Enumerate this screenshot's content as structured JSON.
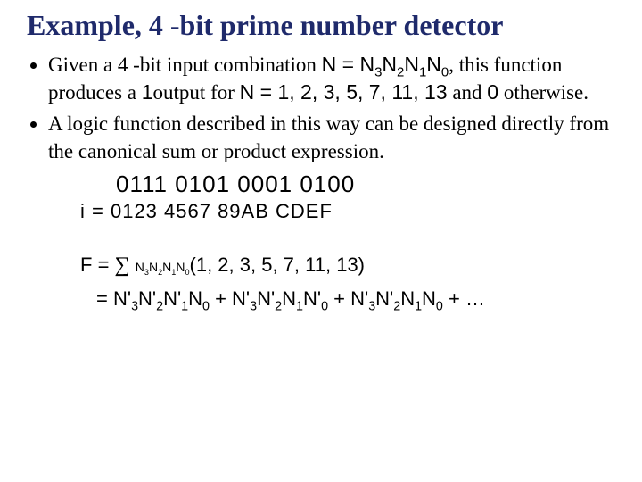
{
  "title": "Example, 4 -bit prime number detector",
  "bullet1_pre": "Given a 4 -bit input combination ",
  "bullet1_N": "N = N",
  "bullet1_s3": "3",
  "bullet1_N2": "N",
  "bullet1_s2": "2",
  "bullet1_N1": "N",
  "bullet1_s1": "1",
  "bullet1_N0": "N",
  "bullet1_s0": "0",
  "bullet1_mid": ", this function produces a ",
  "bullet1_one": "1",
  "bullet1_outfor": "output for ",
  "bullet1_Neq": "N = 1, 2, 3, 5, 7, 11, 13",
  "bullet1_and": " and ",
  "bullet1_zero": "0",
  "bullet1_oth": " otherwise.",
  "bullet2": "A logic function described in this way can be designed directly from the canonical sum or product expression.",
  "binrow": "0111 0101 0001 0100",
  "idx_i": "i = ",
  "idx_vals": "0123 4567 89AB  CDEF",
  "F": "F",
  "eq": " = ",
  "sigma": "∑",
  "sig_sub_N": "N",
  "sig_s3": "3",
  "sig_s2": "2",
  "sig_s1": "1",
  "sig_s0": "0",
  "minterms": "(1, 2, 3, 5, 7, 11, 13)",
  "line2_eq": "= ",
  "t1_a": "N'",
  "t1_3": "3",
  "t1_b": "N'",
  "t1_2": "2",
  "t1_c": "N'",
  "t1_1": "1",
  "t1_d": "N",
  "t1_0": "0",
  "plus": " + ",
  "t2_a": "N'",
  "t2_3": "3",
  "t2_b": "N'",
  "t2_2": "2",
  "t2_c": "N",
  "t2_1": "1",
  "t2_d": "N'",
  "t2_0": "0",
  "t3_a": "N'",
  "t3_3": "3",
  "t3_b": "N'",
  "t3_2": "2",
  "t3_c": "N",
  "t3_1": "1",
  "t3_d": "N",
  "t3_0": "0",
  "ellipsis": " + …"
}
